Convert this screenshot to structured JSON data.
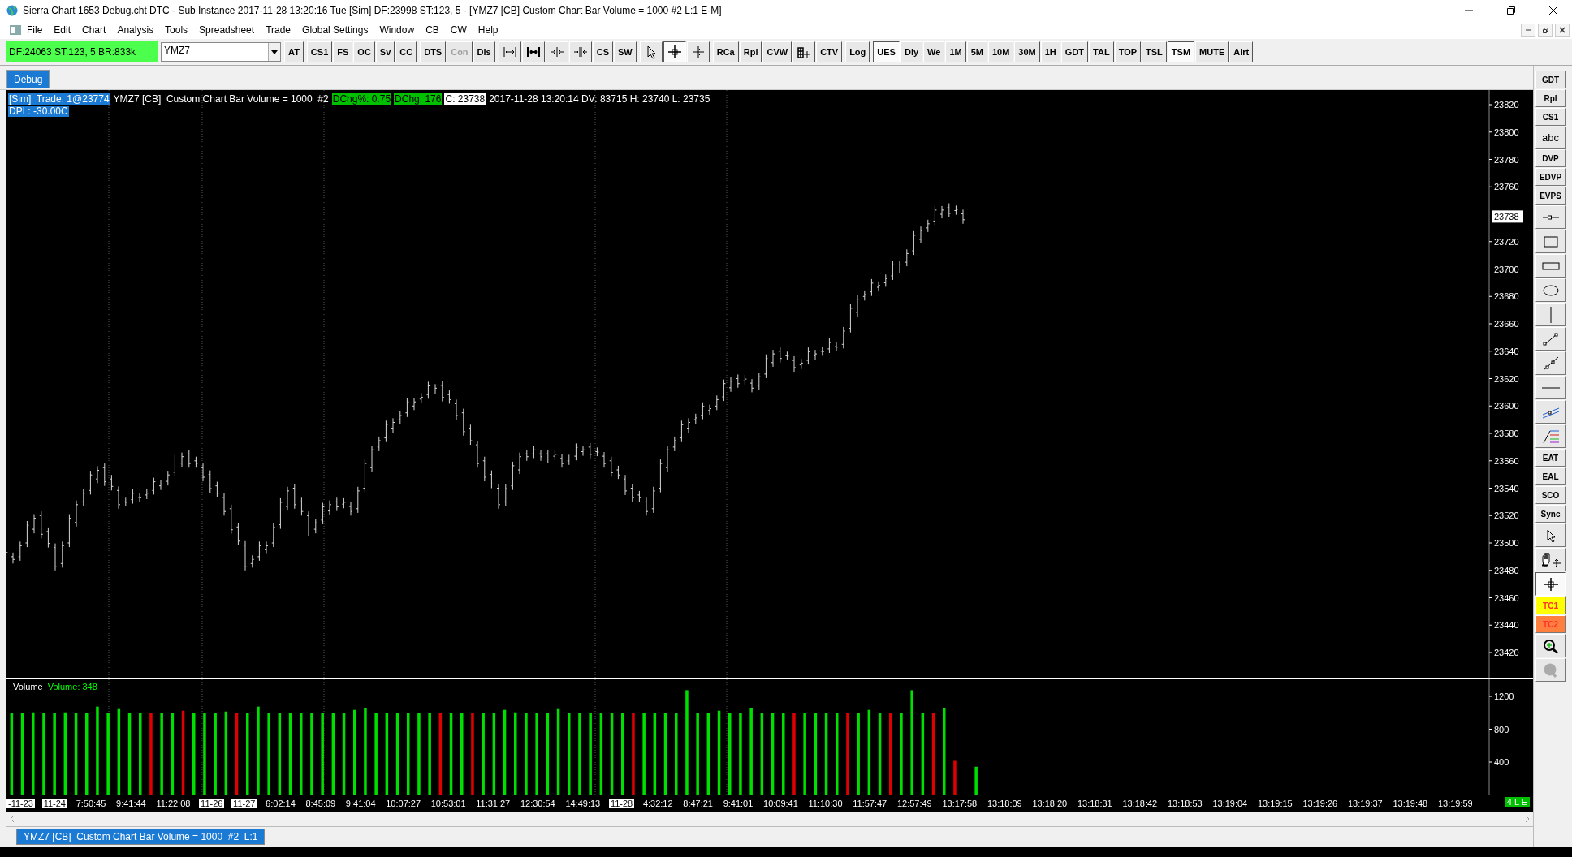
{
  "window": {
    "title": "Sierra Chart 1653 Debug.cht  DTC - Sub Instance 2017-11-28  13:20:16 Tue [Sim]  DF:23998  ST:123, 5 - [YMZ7 [CB]  Custom Chart Bar Volume = 1000  #2  L:1  E-M]"
  },
  "menu": [
    "File",
    "Edit",
    "Chart",
    "Analysis",
    "Tools",
    "Spreadsheet",
    "Trade",
    "Global Settings",
    "Window",
    "CB",
    "CW",
    "Help"
  ],
  "toolbar": {
    "status": "DF:24063  ST:123, 5  BR:833k",
    "symbol": "YMZ7",
    "groups": [
      [
        {
          "kind": "text",
          "label": "AT",
          "pressed": false,
          "disabled": false
        }
      ],
      [
        {
          "kind": "text",
          "label": "CS1",
          "pressed": false,
          "disabled": false
        },
        {
          "kind": "text",
          "label": "FS",
          "pressed": false,
          "disabled": false
        },
        {
          "kind": "text",
          "label": "OC",
          "pressed": false,
          "disabled": false
        },
        {
          "kind": "text",
          "label": "Sv",
          "pressed": false,
          "disabled": false
        },
        {
          "kind": "text",
          "label": "CC",
          "pressed": false,
          "disabled": false
        }
      ],
      [
        {
          "kind": "text",
          "label": "DTS",
          "pressed": false,
          "disabled": false
        },
        {
          "kind": "text",
          "label": "Con",
          "pressed": false,
          "disabled": true
        },
        {
          "kind": "text",
          "label": "Dis",
          "pressed": false,
          "disabled": false
        }
      ],
      [
        {
          "kind": "icon",
          "pressed": false,
          "disabled": false
        },
        {
          "kind": "icon",
          "pressed": false,
          "disabled": false
        },
        {
          "kind": "icon",
          "pressed": false,
          "disabled": false
        },
        {
          "kind": "icon",
          "pressed": false,
          "disabled": false
        },
        {
          "kind": "text",
          "label": "CS",
          "pressed": false,
          "disabled": false
        },
        {
          "kind": "text",
          "label": "SW",
          "pressed": false,
          "disabled": false
        }
      ],
      [
        {
          "kind": "icon",
          "pressed": false,
          "disabled": false
        },
        {
          "kind": "icon",
          "pressed": true,
          "disabled": false
        },
        {
          "kind": "icon",
          "pressed": false,
          "disabled": false
        }
      ],
      [
        {
          "kind": "text",
          "label": "RCa",
          "pressed": false,
          "disabled": false
        },
        {
          "kind": "text",
          "label": "Rpl",
          "pressed": false,
          "disabled": false
        },
        {
          "kind": "text",
          "label": "CVW",
          "pressed": false,
          "disabled": false
        },
        {
          "kind": "icon",
          "pressed": false,
          "disabled": false
        },
        {
          "kind": "text",
          "label": "CTV",
          "pressed": false,
          "disabled": false
        }
      ],
      [
        {
          "kind": "text",
          "label": "Log",
          "pressed": false,
          "disabled": false
        }
      ],
      [
        {
          "kind": "text",
          "label": "UES",
          "pressed": true,
          "disabled": false
        },
        {
          "kind": "text",
          "label": "Dly",
          "pressed": false,
          "disabled": false
        },
        {
          "kind": "text",
          "label": "We",
          "pressed": false,
          "disabled": false
        },
        {
          "kind": "text",
          "label": "1M",
          "pressed": false,
          "disabled": false
        },
        {
          "kind": "text",
          "label": "5M",
          "pressed": false,
          "disabled": false
        },
        {
          "kind": "text",
          "label": "10M",
          "pressed": false,
          "disabled": false
        },
        {
          "kind": "text",
          "label": "30M",
          "pressed": false,
          "disabled": false
        },
        {
          "kind": "text",
          "label": "1H",
          "pressed": false,
          "disabled": false
        },
        {
          "kind": "text",
          "label": "GDT",
          "pressed": false,
          "disabled": false
        },
        {
          "kind": "text",
          "label": "TAL",
          "pressed": false,
          "disabled": false
        },
        {
          "kind": "text",
          "label": "TOP",
          "pressed": false,
          "disabled": false
        },
        {
          "kind": "text",
          "label": "TSL",
          "pressed": false,
          "disabled": false
        },
        {
          "kind": "text",
          "label": "TSM",
          "pressed": true,
          "disabled": false
        },
        {
          "kind": "text",
          "label": "MUTE",
          "pressed": false,
          "disabled": false
        },
        {
          "kind": "text",
          "label": "Alrt",
          "pressed": false,
          "disabled": false
        }
      ]
    ]
  },
  "tabs": [
    {
      "label": "Debug",
      "selected": true
    }
  ],
  "chart_header": [
    [
      {
        "kind": "blue",
        "text": "[Sim]  Trade: 1@23774"
      },
      {
        "kind": "plain",
        "text": "YMZ7 [CB]  Custom Chart Bar Volume = 1000  #2"
      },
      {
        "kind": "green",
        "text": "DChg%: 0.75"
      },
      {
        "kind": "green",
        "text": "DChg: 176"
      },
      {
        "kind": "white",
        "text": "C: 23738"
      },
      {
        "kind": "plain",
        "text": "2017-11-28 13:20:14 DV: 83715 H: 23740 L: 23735"
      }
    ],
    [
      {
        "kind": "blue",
        "text": "DPL: -30.00C"
      }
    ]
  ],
  "price_chart": {
    "current_price": "23738",
    "axis_labels": [
      "23820",
      "23800",
      "23780",
      "23760",
      "23720",
      "23700",
      "23680",
      "23660",
      "23640",
      "23620",
      "23600",
      "23580",
      "23560",
      "23540",
      "23520",
      "23500",
      "23480",
      "23460",
      "23440",
      "23420"
    ]
  },
  "volume_chart": {
    "title": "Volume",
    "reading": "Volume: 348",
    "axis_labels": [
      "1200",
      "800",
      "400"
    ]
  },
  "time_axis": [
    {
      "label": "-11-23",
      "kind": "date"
    },
    {
      "label": "11-24",
      "kind": "date"
    },
    {
      "label": "7:50:45",
      "kind": "time"
    },
    {
      "label": "9:41:44",
      "kind": "time"
    },
    {
      "label": "11:22:08",
      "kind": "time"
    },
    {
      "label": "11-26",
      "kind": "date"
    },
    {
      "label": "11-27",
      "kind": "date"
    },
    {
      "label": "6:02:14",
      "kind": "time"
    },
    {
      "label": "8:45:09",
      "kind": "time"
    },
    {
      "label": "9:41:04",
      "kind": "time"
    },
    {
      "label": "10:07:27",
      "kind": "time"
    },
    {
      "label": "10:53:01",
      "kind": "time"
    },
    {
      "label": "11:31:27",
      "kind": "time"
    },
    {
      "label": "12:30:54",
      "kind": "time"
    },
    {
      "label": "14:49:13",
      "kind": "time"
    },
    {
      "label": "11-28",
      "kind": "date"
    },
    {
      "label": "4:32:12",
      "kind": "time"
    },
    {
      "label": "8:47:21",
      "kind": "time"
    },
    {
      "label": "9:41:01",
      "kind": "time"
    },
    {
      "label": "10:09:41",
      "kind": "time"
    },
    {
      "label": "11:10:30",
      "kind": "time"
    },
    {
      "label": "11:57:47",
      "kind": "time"
    },
    {
      "label": "12:57:49",
      "kind": "time"
    },
    {
      "label": "13:17:58",
      "kind": "time"
    },
    {
      "label": "13:18:09",
      "kind": "time"
    },
    {
      "label": "13:18:20",
      "kind": "time"
    },
    {
      "label": "13:18:31",
      "kind": "time"
    },
    {
      "label": "13:18:42",
      "kind": "time"
    },
    {
      "label": "13:18:53",
      "kind": "time"
    },
    {
      "label": "13:19:04",
      "kind": "time"
    },
    {
      "label": "13:19:15",
      "kind": "time"
    },
    {
      "label": "13:19:26",
      "kind": "time"
    },
    {
      "label": "13:19:37",
      "kind": "time"
    },
    {
      "label": "13:19:48",
      "kind": "time"
    },
    {
      "label": "13:19:59",
      "kind": "time"
    }
  ],
  "status_badge": "4 L E",
  "side_toolbar": [
    {
      "kind": "text",
      "label": "GDT",
      "pressed": false
    },
    {
      "kind": "text",
      "label": "Rpl",
      "pressed": false
    },
    {
      "kind": "text",
      "label": "CS1",
      "pressed": false
    },
    {
      "kind": "large",
      "label": "abc",
      "pressed": false
    },
    {
      "kind": "text",
      "label": "DVP",
      "pressed": false
    },
    {
      "kind": "text",
      "label": "EDVP",
      "pressed": false
    },
    {
      "kind": "text",
      "label": "EVPS",
      "pressed": false
    },
    {
      "kind": "icon",
      "pressed": false
    },
    {
      "kind": "icon",
      "pressed": false
    },
    {
      "kind": "icon",
      "pressed": false
    },
    {
      "kind": "icon",
      "pressed": false
    },
    {
      "kind": "icon",
      "pressed": false
    },
    {
      "kind": "icon",
      "pressed": false
    },
    {
      "kind": "icon",
      "pressed": false
    },
    {
      "kind": "icon",
      "pressed": false
    },
    {
      "kind": "icon",
      "pressed": false
    },
    {
      "kind": "icon",
      "pressed": false
    },
    {
      "kind": "text",
      "label": "EAT",
      "pressed": false
    },
    {
      "kind": "text",
      "label": "EAL",
      "pressed": false
    },
    {
      "kind": "text",
      "label": "SCO",
      "pressed": false
    },
    {
      "kind": "text",
      "label": "Sync",
      "pressed": false
    },
    {
      "kind": "icon",
      "pressed": false
    },
    {
      "kind": "icon",
      "pressed": false
    },
    {
      "kind": "icon",
      "pressed": true
    },
    {
      "kind": "text",
      "label": "TC1",
      "pressed": false,
      "color": "#ffff00"
    },
    {
      "kind": "text",
      "label": "TC2",
      "pressed": false,
      "color": "#ff7f3f"
    },
    {
      "kind": "icon",
      "pressed": false
    },
    {
      "kind": "icon",
      "pressed": false
    }
  ],
  "bottom_tabs": [
    {
      "label": "YMZ7 [CB]  Custom Chart Bar Volume = 1000  #2  L:1",
      "selected": true
    }
  ]
}
